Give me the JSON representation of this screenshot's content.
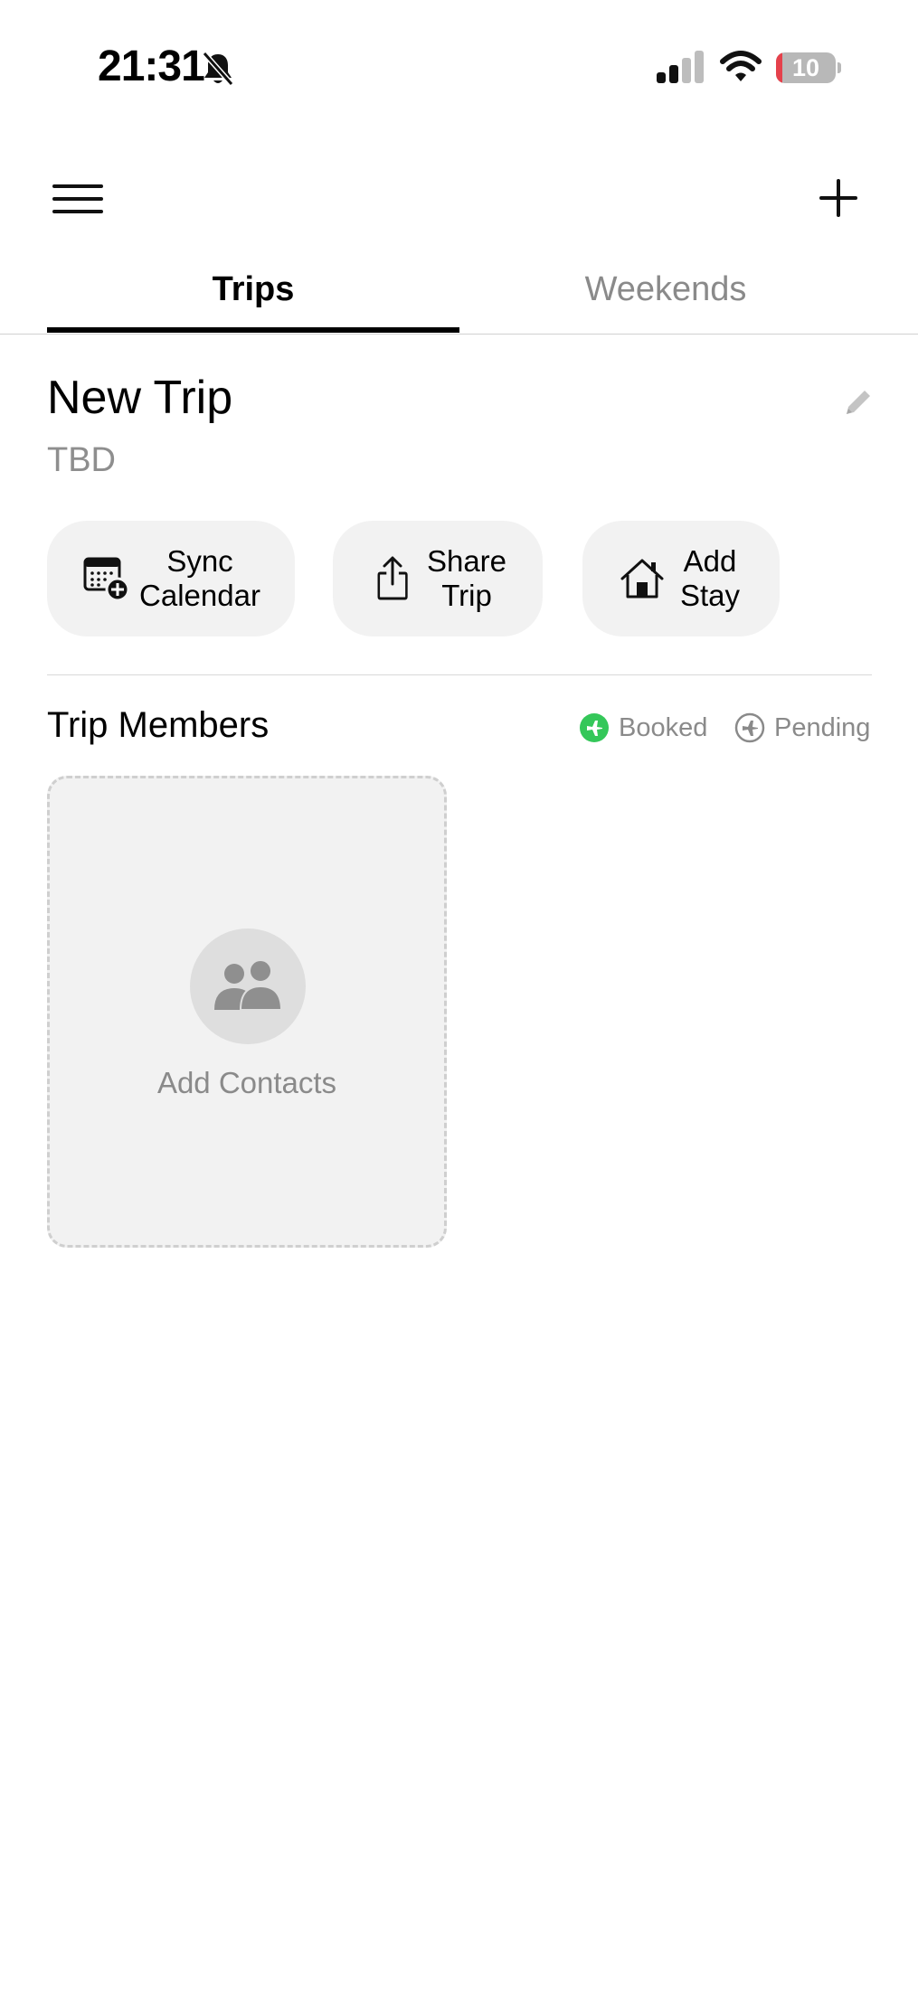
{
  "status_bar": {
    "time": "21:31",
    "battery_level": "10",
    "battery_fraction": 0.1,
    "battery_color": "#e5414b",
    "icons": [
      "bell-slash-icon",
      "cellular-signal-icon",
      "wifi-icon",
      "battery-icon"
    ]
  },
  "nav": {
    "menu_icon": "hamburger-menu-icon",
    "add_icon": "plus-icon"
  },
  "tabs": [
    {
      "label": "Trips",
      "active": true
    },
    {
      "label": "Weekends",
      "active": false
    }
  ],
  "trip": {
    "title": "New Trip",
    "subtitle": "TBD",
    "edit_icon": "pencil-icon"
  },
  "actions": [
    {
      "label_line1": "Sync",
      "label_line2": "Calendar",
      "icon": "calendar-add-icon"
    },
    {
      "label_line1": "Share",
      "label_line2": "Trip",
      "icon": "share-icon"
    },
    {
      "label_line1": "Add",
      "label_line2": "Stay",
      "icon": "house-icon"
    }
  ],
  "members": {
    "title": "Trip Members",
    "legend": [
      {
        "label": "Booked",
        "color": "#34c759",
        "icon": "plane-filled-icon"
      },
      {
        "label": "Pending",
        "color": "#8a8a8a",
        "icon": "plane-outline-icon"
      }
    ],
    "add_contacts_label": "Add Contacts",
    "add_contacts_icon": "people-icon"
  }
}
